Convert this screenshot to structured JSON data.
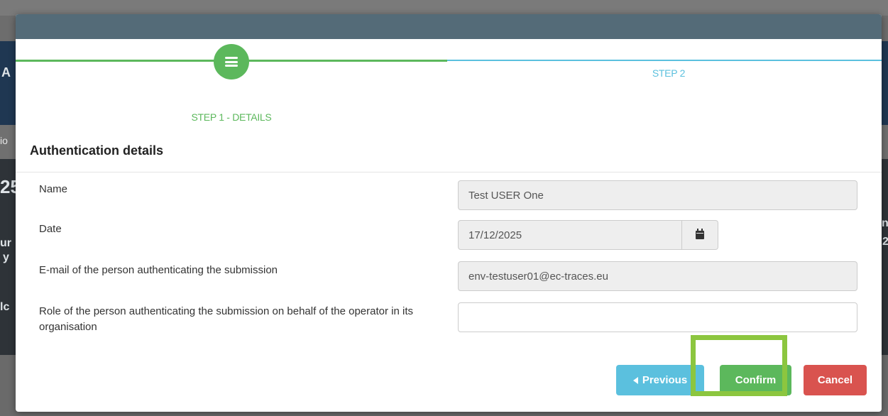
{
  "background": {
    "fragments": [
      "A",
      "io",
      "25",
      "ur",
      "y",
      "lc",
      "n",
      "2"
    ]
  },
  "wizard": {
    "step1_icon": "menu-icon",
    "step1_label": "STEP 1 - DETAILS",
    "step2_label": "STEP 2"
  },
  "section": {
    "title": "Authentication details"
  },
  "fields": {
    "name": {
      "label": "Name",
      "value": "Test USER One"
    },
    "date": {
      "label": "Date",
      "value": "17/12/2025",
      "icon": "calendar-icon"
    },
    "email": {
      "label": "E-mail of the person authenticating the submission",
      "value": "env-testuser01@ec-traces.eu"
    },
    "role": {
      "label": "Role of the person authenticating the submission on behalf of the operator in its organisation",
      "value": ""
    }
  },
  "buttons": {
    "previous": "Previous",
    "confirm": "Confirm",
    "cancel": "Cancel"
  },
  "colors": {
    "success": "#5cb85c",
    "info": "#5bc0de",
    "danger": "#d9534f",
    "highlight": "#8cc63f",
    "header": "#546b78"
  }
}
